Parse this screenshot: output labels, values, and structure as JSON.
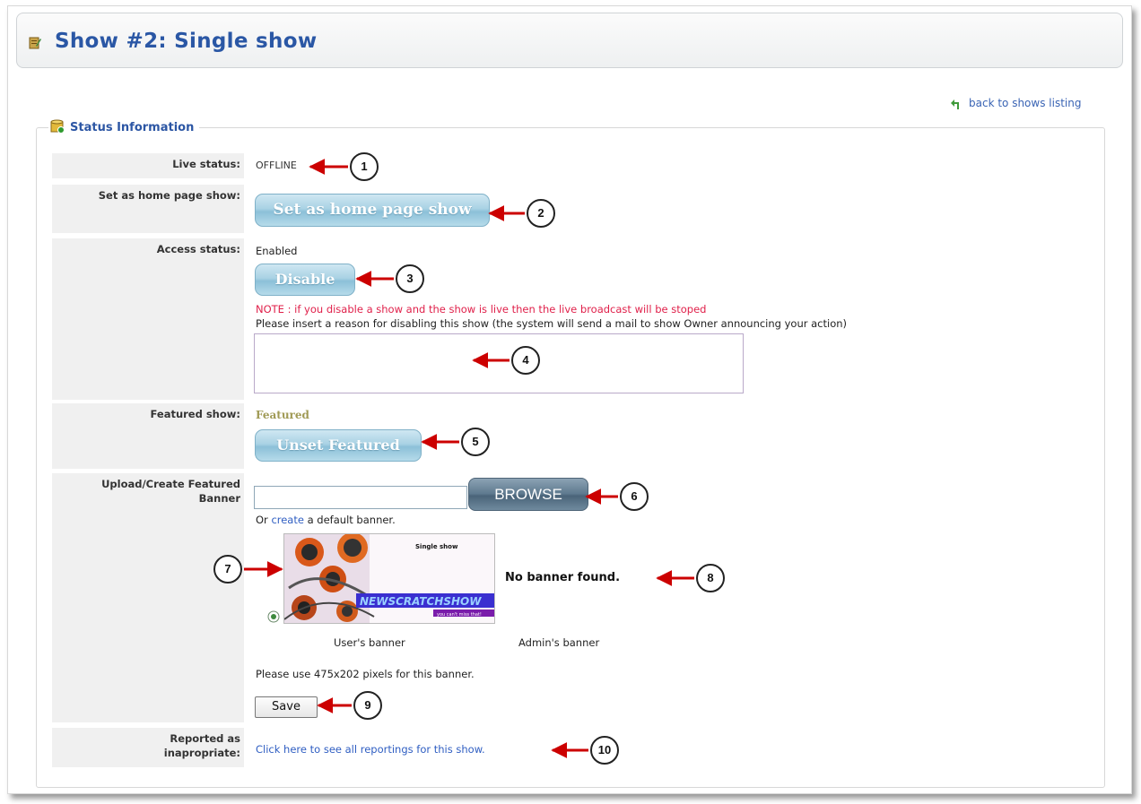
{
  "header": {
    "title": "Show #2: Single show"
  },
  "back_link": "back to shows listing",
  "section": {
    "legend": "Status Information"
  },
  "rows": {
    "live_status": {
      "label": "Live status:",
      "value": "OFFLINE"
    },
    "home_page": {
      "label": "Set as home page show:",
      "button": "Set as home page show"
    },
    "access": {
      "label": "Access status:",
      "value": "Enabled",
      "button": "Disable",
      "note": "NOTE : if you disable a show and the show is live then the live broadcast will be stoped",
      "instruction": "Please insert a reason for disabling this show (the system will send a mail to show Owner announcing your action)",
      "reason_value": ""
    },
    "featured": {
      "label": "Featured show:",
      "value": "Featured",
      "button": "Unset Featured"
    },
    "banner": {
      "label_line1": "Upload/Create Featured",
      "label_line2": "Banner",
      "file_value": "",
      "browse_label": "BROWSE",
      "or_text": "Or",
      "create_link": "create",
      "default_text": "a default banner.",
      "users_banner_caption": "User's banner",
      "admins_banner_caption": "Admin's banner",
      "no_banner_text": "No banner found.",
      "size_hint": "Please use 475x202 pixels for this banner.",
      "save_label": "Save",
      "preview": {
        "title_text": "Single show",
        "logo_text": "NEWSCRATCHSHOW",
        "tagline": "you can't miss that!"
      }
    },
    "reported": {
      "label_line1": "Reported as",
      "label_line2": "inapropriate:",
      "link": "Click here to see all reportings for this show."
    }
  },
  "callouts": [
    "1",
    "2",
    "3",
    "4",
    "5",
    "6",
    "7",
    "8",
    "9",
    "10"
  ],
  "colors": {
    "title": "#2a57a5",
    "link": "#2f5ec2",
    "note": "#e0204a",
    "featured": "#a09a55",
    "arrow": "#cc0000",
    "label_bg": "#f0f0f0"
  }
}
